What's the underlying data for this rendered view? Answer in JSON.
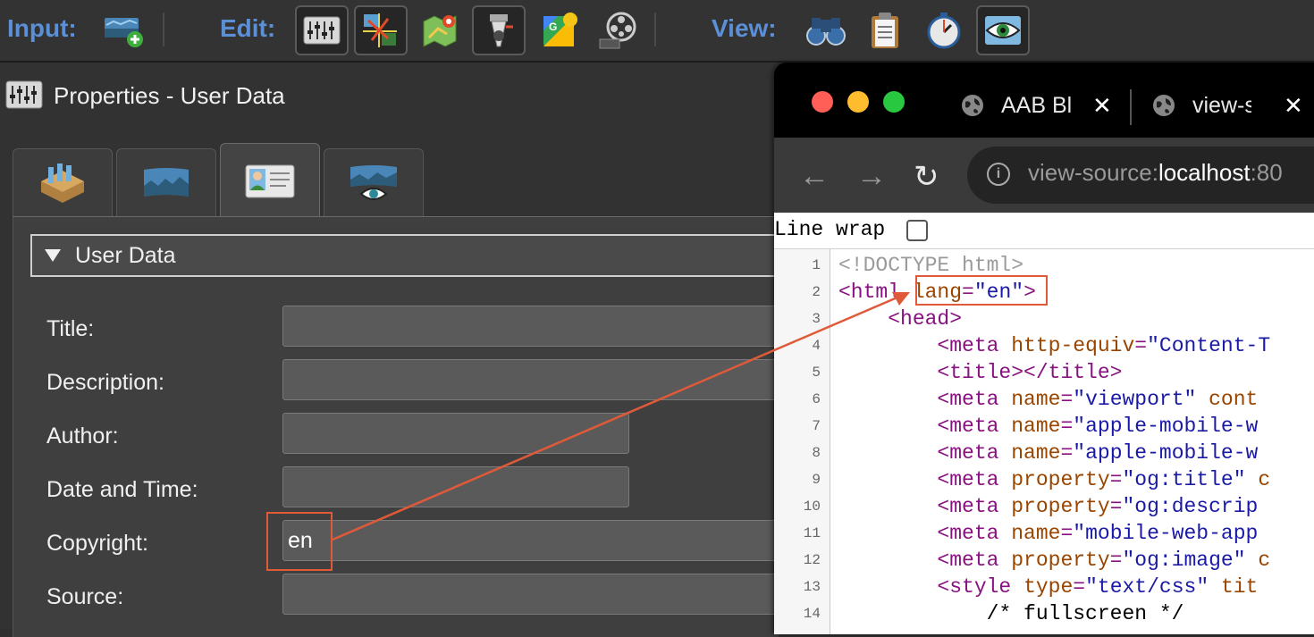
{
  "toolbar": {
    "input_label": "Input:",
    "edit_label": "Edit:",
    "view_label": "View:"
  },
  "properties": {
    "title": "Properties - User Data",
    "section_title": "User Data",
    "fields": [
      {
        "label": "Title:",
        "value": ""
      },
      {
        "label": "Description:",
        "value": ""
      },
      {
        "label": "Author:",
        "value": ""
      },
      {
        "label": "Date and Time:",
        "value": ""
      },
      {
        "label": "Copyright:",
        "value": "en"
      },
      {
        "label": "Source:",
        "value": ""
      }
    ]
  },
  "browser": {
    "tabs": [
      {
        "title": "AAB Bl",
        "close": "✕"
      },
      {
        "title": "view-sc",
        "close": "✕"
      }
    ],
    "url_scheme": "view-source:",
    "url_host": "localhost",
    "url_rest": ":80",
    "line_wrap_label": "Line wrap",
    "line_wrap_checked": false,
    "lines": [
      {
        "n": "1"
      },
      {
        "n": "2"
      },
      {
        "n": "3"
      },
      {
        "n": "4"
      },
      {
        "n": "5"
      },
      {
        "n": "6"
      },
      {
        "n": "7"
      },
      {
        "n": "8"
      },
      {
        "n": "9"
      },
      {
        "n": "10"
      },
      {
        "n": "11"
      },
      {
        "n": "12"
      },
      {
        "n": "13"
      },
      {
        "n": "14"
      }
    ]
  },
  "colors": {
    "accent_blue": "#5b8fd6",
    "annotation": "#e05a3a"
  },
  "icons": {
    "toolbar": [
      "add-panorama-icon",
      "properties-icon",
      "control-points-icon",
      "map-icon",
      "tour-icon",
      "google-maps-icon",
      "animation-icon",
      "binoculars-icon",
      "clipboard-icon",
      "timer-icon",
      "preview-eye-icon"
    ]
  }
}
